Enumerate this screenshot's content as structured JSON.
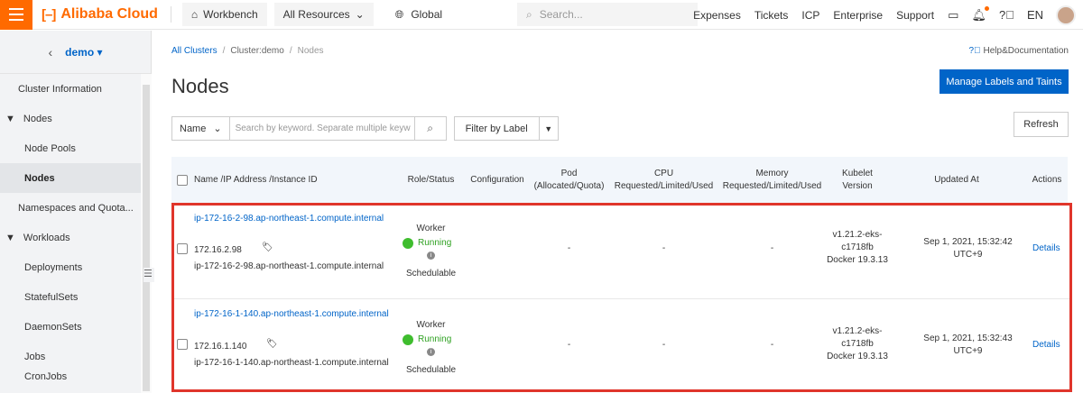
{
  "topbar": {
    "brand": "Alibaba Cloud",
    "workbench": "Workbench",
    "all_resources": "All Resources",
    "region": "Global",
    "search_placeholder": "Search...",
    "links": [
      "Expenses",
      "Tickets",
      "ICP",
      "Enterprise",
      "Support"
    ],
    "language": "EN"
  },
  "sidebar": {
    "project": "demo",
    "items": [
      {
        "label": "Cluster Information"
      },
      {
        "label": "Nodes"
      },
      {
        "label": "Node Pools"
      },
      {
        "label": "Nodes"
      },
      {
        "label": "Namespaces and Quota..."
      },
      {
        "label": "Workloads"
      },
      {
        "label": "Deployments"
      },
      {
        "label": "StatefulSets"
      },
      {
        "label": "DaemonSets"
      },
      {
        "label": "Jobs"
      },
      {
        "label": "CronJobs"
      }
    ]
  },
  "breadcrumb": {
    "items": [
      "All Clusters",
      "Cluster:demo",
      "Nodes"
    ]
  },
  "help_label": "Help&Documentation",
  "page_title": "Nodes",
  "manage_button": "Manage Labels and Taints",
  "refresh_button": "Refresh",
  "filters": {
    "field": "Name",
    "keyword_placeholder": "Search by keyword. Separate multiple keyw",
    "filter_label": "Filter by Label"
  },
  "table": {
    "headers": {
      "name": "Name /IP Address /Instance ID",
      "role": "Role/Status",
      "config": "Configuration",
      "pod_1": "Pod",
      "pod_2": "(Allocated/Quota)",
      "cpu_1": "CPU",
      "cpu_2": "Requested/Limited/Used",
      "mem_1": "Memory",
      "mem_2": "Requested/Limited/Used",
      "kubelet_1": "Kubelet",
      "kubelet_2": "Version",
      "updated": "Updated At",
      "actions": "Actions"
    },
    "rows": [
      {
        "name": "ip-172-16-2-98.ap-northeast-1.compute.internal",
        "ip": "172.16.2.98",
        "instance": "ip-172-16-2-98.ap-northeast-1.compute.internal",
        "role": "Worker",
        "status": "Running",
        "schedulable": "Schedulable",
        "config": "",
        "pod": "-",
        "cpu": "-",
        "memory": "-",
        "kubelet_1": "v1.21.2-eks-",
        "kubelet_2": "c1718fb",
        "kubelet_3": "Docker 19.3.13",
        "updated_1": "Sep 1, 2021, 15:32:42",
        "updated_2": "UTC+9",
        "action": "Details"
      },
      {
        "name": "ip-172-16-1-140.ap-northeast-1.compute.internal",
        "ip": "172.16.1.140",
        "instance": "ip-172-16-1-140.ap-northeast-1.compute.internal",
        "role": "Worker",
        "status": "Running",
        "schedulable": "Schedulable",
        "config": "",
        "pod": "-",
        "cpu": "-",
        "memory": "-",
        "kubelet_1": "v1.21.2-eks-",
        "kubelet_2": "c1718fb",
        "kubelet_3": "Docker 19.3.13",
        "updated_1": "Sep 1, 2021, 15:32:43",
        "updated_2": "UTC+9",
        "action": "Details"
      }
    ]
  },
  "colors": {
    "accent": "#ff6a00",
    "primary": "#0064c8",
    "running": "#3fbd2e",
    "highlight": "#e0352b"
  }
}
